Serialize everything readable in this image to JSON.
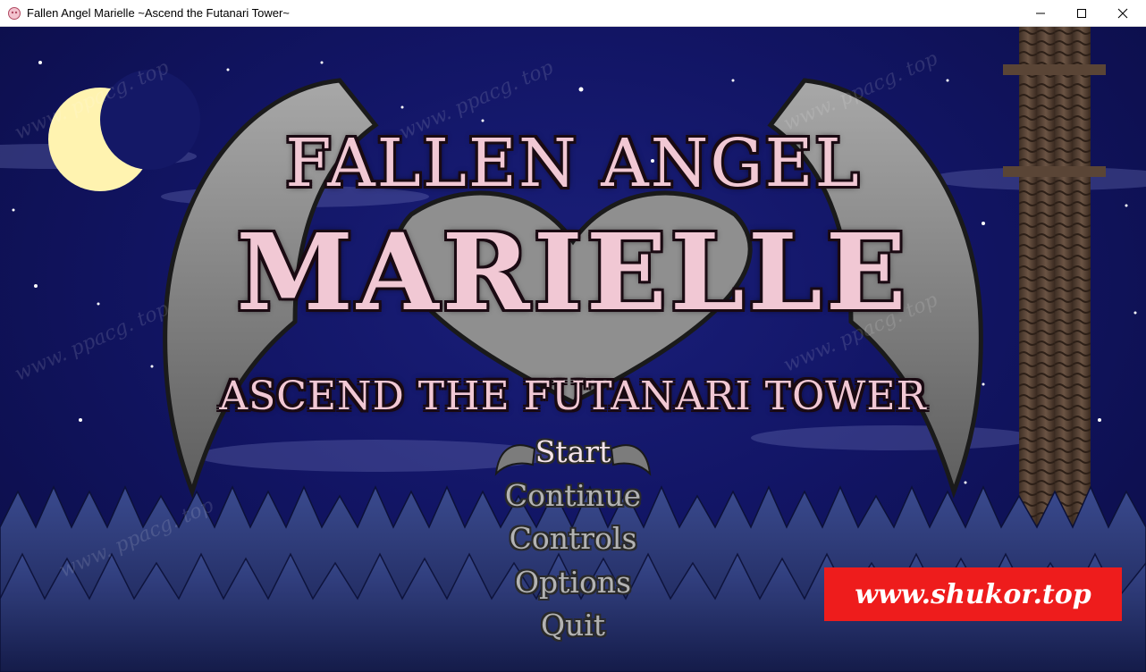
{
  "window": {
    "title": "Fallen Angel Marielle ~Ascend the Futanari Tower~",
    "minimize_icon": "minimize-icon",
    "maximize_icon": "maximize-icon",
    "close_icon": "close-icon"
  },
  "logo": {
    "line1": "FALLEN ANGEL",
    "line2": "MARIELLE",
    "line3": "ASCEND THE FUTANARI TOWER"
  },
  "menu": {
    "items": [
      {
        "label": "Start",
        "selected": true
      },
      {
        "label": "Continue",
        "selected": false
      },
      {
        "label": "Controls",
        "selected": false
      },
      {
        "label": "Options",
        "selected": false
      },
      {
        "label": "Quit",
        "selected": false
      }
    ]
  },
  "watermark": {
    "banner": "www.shukor.top",
    "overlay": "www. ppacg. top"
  },
  "colors": {
    "sky": "#121565",
    "moon": "#fff3b0",
    "logo_pink": "#f1c8d4",
    "wings": "#8c8c8c",
    "banner_red": "#ee1c1c"
  }
}
